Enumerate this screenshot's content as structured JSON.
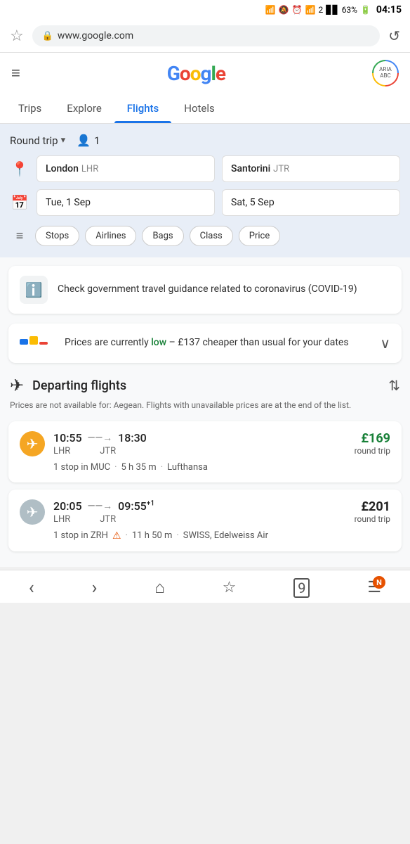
{
  "statusBar": {
    "time": "04:15",
    "battery": "63%",
    "icons": "bluetooth mute alarm wifi signal"
  },
  "browser": {
    "url": "www.google.com",
    "starIcon": "☆",
    "lockIcon": "🔒",
    "reloadIcon": "↺"
  },
  "header": {
    "menuIcon": "≡",
    "logoText": "Google",
    "avatarText": "ARIA\nABC"
  },
  "nav": {
    "tabs": [
      {
        "label": "Trips",
        "active": false
      },
      {
        "label": "Explore",
        "active": false
      },
      {
        "label": "Flights",
        "active": true
      },
      {
        "label": "Hotels",
        "active": false
      }
    ]
  },
  "search": {
    "tripType": "Round trip",
    "passengers": "1",
    "origin": "London",
    "originCode": "LHR",
    "destination": "Santorini",
    "destinationCode": "JTR",
    "departDate": "Tue, 1 Sep",
    "returnDate": "Sat, 5 Sep",
    "filters": [
      "Stops",
      "Airlines",
      "Bags",
      "Class",
      "Price"
    ]
  },
  "covidCard": {
    "icon": "ℹ",
    "text": "Check government travel guidance related to coronavirus (COVID-19)"
  },
  "priceCard": {
    "text1": "Prices are currently ",
    "low": "low",
    "text2": " – £137 cheaper than usual for your dates",
    "expandIcon": "∨"
  },
  "departingSection": {
    "title": "Departing flights",
    "note": "Prices are not available for: Aegean. Flights with unavailable prices are at the end of the list."
  },
  "flights": [
    {
      "airlineLogo": "✈",
      "logoColor": "#F5A623",
      "departTime": "10:55",
      "arriveTime": "18:30",
      "departAirport": "LHR",
      "arriveAirport": "JTR",
      "price": "£169",
      "priceColor": "green",
      "priceLabel": "round trip",
      "stops": "1 stop in MUC",
      "duration": "5 h 35 m",
      "airline": "Lufthansa",
      "hasWarning": false,
      "nextDay": false
    },
    {
      "airlineLogo": "✈",
      "logoColor": "#b0bec5",
      "departTime": "20:05",
      "arriveTime": "09:55",
      "departAirport": "LHR",
      "arriveAirport": "JTR",
      "price": "£201",
      "priceColor": "black",
      "priceLabel": "round trip",
      "stops": "1 stop in ZRH",
      "duration": "11 h 50 m",
      "airline": "SWISS, Edelweiss Air",
      "hasWarning": true,
      "nextDay": true
    }
  ],
  "bottomNav": {
    "back": "‹",
    "forward": "›",
    "home": "⌂",
    "star": "☆",
    "tabs": "⊡",
    "menu": "☰",
    "notificationLabel": "N"
  }
}
